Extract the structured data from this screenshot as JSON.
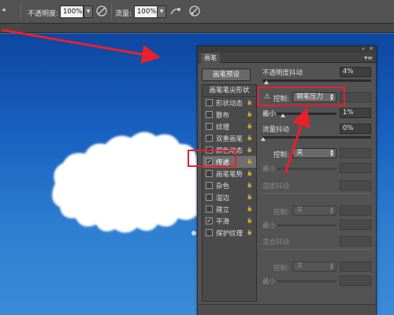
{
  "options_bar": {
    "opacity_label": "不透明度:",
    "opacity_value": "100%",
    "flow_label": "流量:",
    "flow_value": "100%",
    "icons": [
      "pressure-opacity-icon",
      "airbrush-icon",
      "pressure-size-icon"
    ]
  },
  "panel": {
    "tab_label": "画笔",
    "preset_button": "画笔预设",
    "tip_shape_header": "画笔笔尖形状",
    "items": [
      {
        "label": "形状动态",
        "checked": false,
        "active": false
      },
      {
        "label": "散布",
        "checked": false,
        "active": false
      },
      {
        "label": "纹理",
        "checked": false,
        "active": false
      },
      {
        "label": "双重画笔",
        "checked": false,
        "active": false
      },
      {
        "label": "颜色动态",
        "checked": false,
        "active": false
      },
      {
        "label": "传递",
        "checked": true,
        "active": true
      },
      {
        "label": "画笔笔势",
        "checked": false,
        "active": false
      },
      {
        "label": "杂色",
        "checked": false,
        "active": false
      },
      {
        "label": "湿边",
        "checked": false,
        "active": false
      },
      {
        "label": "建立",
        "checked": false,
        "active": false
      },
      {
        "label": "平滑",
        "checked": true,
        "active": false
      },
      {
        "label": "保护纹理",
        "checked": false,
        "active": false
      }
    ],
    "opacity_jitter_label": "不透明度抖动",
    "opacity_jitter_value": "4%",
    "control_label": "控制:",
    "control_value": "钢笔压力",
    "minimum_label": "最小",
    "minimum_value": "1%",
    "flow_jitter_label": "流量抖动",
    "flow_jitter_value": "0%",
    "flow_control_label": "控制:",
    "flow_control_value": "关",
    "flow_minimum_label": "最小",
    "wetness_jitter_label": "湿度抖动",
    "wet_control_label": "控制:",
    "wet_control_value": "关",
    "wet_minimum_label": "最小",
    "mix_jitter_label": "混合抖动",
    "mix_control_label": "控制:",
    "mix_control_value": "关",
    "mix_minimum_label": "最小"
  },
  "colors": {
    "annotation": "#e8212b",
    "panel_bg": "#535353",
    "sky_top": "#0d47a1",
    "sky_bottom": "#3b8bd8"
  }
}
